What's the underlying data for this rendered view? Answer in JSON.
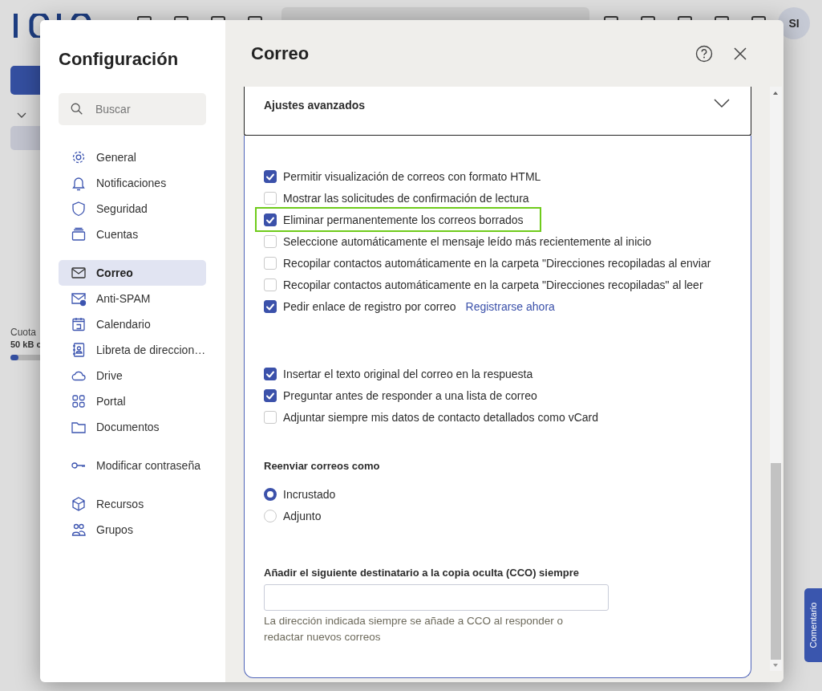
{
  "background": {
    "avatar": "SI",
    "quota_label": "Cuota",
    "quota_value": "50 kB c",
    "feedback_tab": "Comentario"
  },
  "dialog": {
    "title": "Configuración",
    "search": {
      "placeholder": "Buscar"
    },
    "nav": [
      [
        {
          "label": "General",
          "selected": false
        },
        {
          "label": "Notificaciones",
          "selected": false
        },
        {
          "label": "Seguridad",
          "selected": false
        },
        {
          "label": "Cuentas",
          "selected": false
        }
      ],
      [
        {
          "label": "Correo",
          "selected": true
        },
        {
          "label": "Anti-SPAM",
          "selected": false
        },
        {
          "label": "Calendario",
          "selected": false
        },
        {
          "label": "Libreta de direccion…",
          "selected": false
        },
        {
          "label": "Drive",
          "selected": false
        },
        {
          "label": "Portal",
          "selected": false
        },
        {
          "label": "Documentos",
          "selected": false
        }
      ],
      [
        {
          "label": "Modificar contraseña",
          "selected": false
        }
      ],
      [
        {
          "label": "Recursos",
          "selected": false
        },
        {
          "label": "Grupos",
          "selected": false
        }
      ]
    ],
    "section_title": "Correo",
    "expander": {
      "title": "Ajustes avanzados"
    },
    "options": [
      {
        "label": "Permitir visualización de correos con formato HTML",
        "checked": true,
        "highlighted": false
      },
      {
        "label": "Mostrar las solicitudes de confirmación de lectura",
        "checked": false,
        "highlighted": false
      },
      {
        "label": "Eliminar permanentemente los correos borrados",
        "checked": true,
        "highlighted": true
      },
      {
        "label": "Seleccione automáticamente el mensaje leído más recientemente al inicio",
        "checked": false,
        "highlighted": false
      },
      {
        "label": "Recopilar contactos automáticamente en la carpeta \"Direcciones recopiladas al enviar",
        "checked": false,
        "highlighted": false
      },
      {
        "label": "Recopilar contactos automáticamente en la carpeta \"Direcciones recopiladas\" al leer",
        "checked": false,
        "highlighted": false
      },
      {
        "label": "Pedir enlace de registro por correo",
        "checked": true,
        "highlighted": false,
        "link": "Registrarse ahora"
      }
    ],
    "reply_options": [
      {
        "label": "Insertar el texto original del correo en la respuesta",
        "checked": true,
        "highlighted": false
      },
      {
        "label": "Preguntar antes de responder a una lista de correo",
        "checked": true,
        "highlighted": false
      },
      {
        "label": "Adjuntar siempre mis datos de contacto detallados como vCard",
        "checked": false,
        "highlighted": false
      }
    ],
    "forward": {
      "title": "Reenviar correos como",
      "choices": [
        {
          "label": "Incrustado",
          "selected": true
        },
        {
          "label": "Adjunto",
          "selected": false
        }
      ]
    },
    "bcc": {
      "label": "Añadir el siguiente destinatario a la copia oculta (CCO) siempre",
      "hint": "La dirección indicada siempre se añade a CCO al responder o redactar nuevos correos"
    }
  }
}
